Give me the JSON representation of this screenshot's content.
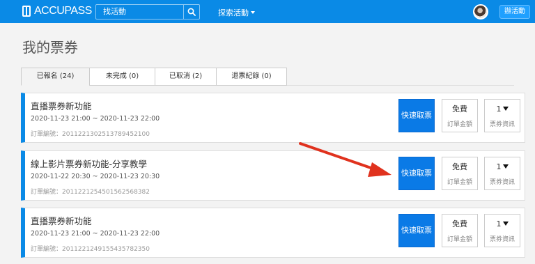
{
  "topbar": {
    "logo_text": "ACCUPASS",
    "search_value": "找活動",
    "explore_label": "探索活動",
    "host_button_label": "辦活動"
  },
  "page": {
    "title": "我的票券"
  },
  "tabs": [
    {
      "label": "已報名 (24)",
      "active": true
    },
    {
      "label": "未完成 (0)",
      "active": false
    },
    {
      "label": "已取消 (2)",
      "active": false
    },
    {
      "label": "退票紀錄 (0)",
      "active": false
    }
  ],
  "tickets": [
    {
      "title": "直播票券新功能",
      "time": "2020-11-23 21:00 ~ 2020-11-23 22:00",
      "order": "訂單編號：201122130251378945210​0",
      "quick_label": "快速取票",
      "price": "免費",
      "price_label": "訂單金額",
      "qty": "1",
      "qty_label": "票券資訊"
    },
    {
      "title": "線上影片票券新功能-分享教學",
      "time": "2020-11-22 20:30 ~ 2020-11-23 20:30",
      "order": "訂單編號：201122125450156256838​2",
      "quick_label": "快速取票",
      "price": "免費",
      "price_label": "訂單金額",
      "qty": "1",
      "qty_label": "票券資訊"
    },
    {
      "title": "直播票券新功能",
      "time": "2020-11-23 21:00 ~ 2020-11-23 22:00",
      "order": "訂單編號：201122124915543578235​0",
      "quick_label": "快速取票",
      "price": "免費",
      "price_label": "訂單金額",
      "qty": "1",
      "qty_label": "票券資訊"
    }
  ],
  "colors": {
    "brand": "#0a8ae6",
    "annotation_arrow": "#e0321e"
  }
}
